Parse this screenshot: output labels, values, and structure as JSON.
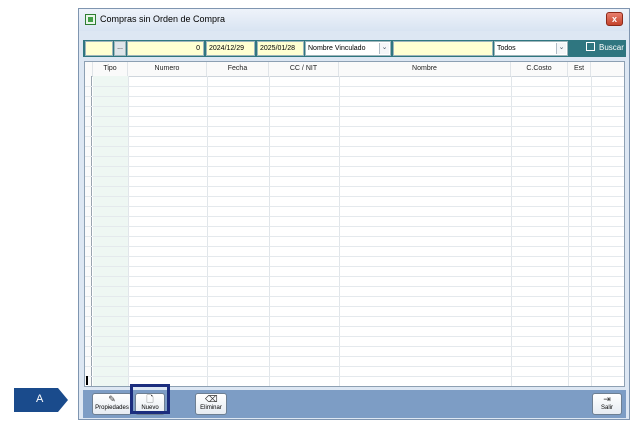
{
  "window": {
    "title": "Compras sin Orden de Compra",
    "close_label": "x"
  },
  "toolbar": {
    "field1_value": "",
    "ellipsis_label": "...",
    "number_value": "0",
    "date_from": "2024/12/29",
    "date_to": "2025/01/28",
    "name_filter_selected": "Nombre Vinculado",
    "search_text": "",
    "status_selected": "Todos",
    "dropdown_arrow": "⌄",
    "search_label": "Buscar"
  },
  "grid": {
    "columns": [
      "Tipo",
      "Numero",
      "Fecha",
      "CC / NIT",
      "Nombre",
      "C.Costo",
      "Est"
    ],
    "rows": []
  },
  "bottom": {
    "propiedades_label": "Propiedades",
    "nuevo_label": "Nuevo",
    "eliminar_label": "Eliminar",
    "salir_label": "Salir"
  },
  "callout": {
    "label": "A"
  },
  "colors": {
    "toolbar_bg": "#2f7680",
    "bottombar_bg": "#7d9dc5",
    "input_yellow": "#ffffd2",
    "highlight_border": "#1b2d7e",
    "callout_bg": "#1a4b8c"
  },
  "icons": {
    "propiedades": "edit-properties-icon",
    "nuevo": "new-document-icon",
    "eliminar": "eraser-icon",
    "salir": "exit-door-icon",
    "buscar": "search-binoculars-icon"
  }
}
